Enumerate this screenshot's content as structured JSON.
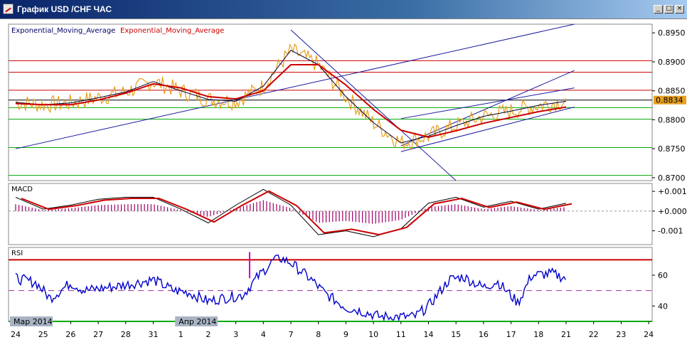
{
  "window": {
    "title": "График USD /CHF ЧАС",
    "minimize_label": "_",
    "maximize_label": "□",
    "close_label": "×"
  },
  "legend": {
    "ema1": "Exponential_Moving_Average",
    "ema2": "Exponential_Moving_Average",
    "macd": "MACD",
    "rsi": "RSI"
  },
  "colors": {
    "price": "#e8a020",
    "ema_fast": "#000033",
    "ema_slow": "#cc0000",
    "trend": "#1a1aa0",
    "level_red": "#cc0000",
    "level_green": "#00aa00",
    "macd_hist": "#990066",
    "rsi_line": "#0000cc",
    "rsi_spike": "#cc00cc",
    "current_badge": "#e8a020"
  },
  "current_price": "0.8834",
  "chart_data": [
    {
      "type": "line",
      "title": "",
      "ylim": [
        0.8695,
        0.8965
      ],
      "yticks": [
        "0.8950",
        "0.8900",
        "0.8850",
        "0.8800",
        "0.8750",
        "0.8700"
      ],
      "ytick_values": [
        0.895,
        0.89,
        0.885,
        0.88,
        0.875,
        0.87
      ],
      "x_labels": [
        "24",
        "25",
        "26",
        "27",
        "28",
        "31",
        "1",
        "2",
        "3",
        "4",
        "7",
        "8",
        "9",
        "10",
        "11",
        "14",
        "15",
        "16",
        "17",
        "18",
        "21",
        "22",
        "23",
        "24"
      ],
      "period_labels": [
        "Мар 2014",
        "Апр 2014"
      ],
      "horizontal_levels": {
        "red": [
          0.8902,
          0.8882,
          0.8851
        ],
        "black": [
          0.8834
        ],
        "green": [
          0.8821,
          0.8801,
          0.8752,
          0.8704
        ]
      },
      "series": [
        {
          "name": "Exponential_Moving_Average",
          "points": [
            [
              0,
              0.883
            ],
            [
              1,
              0.8826
            ],
            [
              2,
              0.8829
            ],
            [
              3,
              0.8838
            ],
            [
              4,
              0.8848
            ],
            [
              5,
              0.8866
            ],
            [
              6,
              0.885
            ],
            [
              7,
              0.8835
            ],
            [
              8,
              0.8832
            ],
            [
              9,
              0.8858
            ],
            [
              10,
              0.892
            ],
            [
              11,
              0.8895
            ],
            [
              12,
              0.884
            ],
            [
              13,
              0.8795
            ],
            [
              14,
              0.876
            ],
            [
              15,
              0.8772
            ],
            [
              16,
              0.879
            ],
            [
              17,
              0.8806
            ],
            [
              18,
              0.8815
            ],
            [
              19,
              0.8825
            ],
            [
              20,
              0.8832
            ]
          ]
        },
        {
          "name": "Exponential_Moving_Average",
          "points": [
            [
              0,
              0.8828
            ],
            [
              1,
              0.8826
            ],
            [
              2,
              0.8826
            ],
            [
              3,
              0.8834
            ],
            [
              4,
              0.8846
            ],
            [
              5,
              0.8862
            ],
            [
              6,
              0.8855
            ],
            [
              7,
              0.884
            ],
            [
              8,
              0.8836
            ],
            [
              9,
              0.885
            ],
            [
              10,
              0.8895
            ],
            [
              11,
              0.8895
            ],
            [
              12,
              0.886
            ],
            [
              13,
              0.8818
            ],
            [
              14,
              0.8782
            ],
            [
              15,
              0.877
            ],
            [
              16,
              0.8781
            ],
            [
              17,
              0.8794
            ],
            [
              18,
              0.8804
            ],
            [
              19,
              0.8814
            ],
            [
              20,
              0.8822
            ]
          ]
        }
      ]
    },
    {
      "type": "line",
      "title": "",
      "ylim": [
        -0.0017,
        0.0014
      ],
      "yticks": [
        "+0.001",
        "+0.000",
        "-0.001"
      ],
      "ytick_values": [
        0.001,
        0.0,
        -0.001
      ],
      "series": [
        {
          "name": "MACD",
          "points": [
            [
              0,
              0.0007
            ],
            [
              1,
              0.0001
            ],
            [
              2,
              0.0003
            ],
            [
              3,
              0.0006
            ],
            [
              4,
              0.0007
            ],
            [
              5,
              0.0007
            ],
            [
              6,
              0.0001
            ],
            [
              7,
              -0.0006
            ],
            [
              8,
              0.0003
            ],
            [
              9,
              0.0011
            ],
            [
              10,
              0.0003
            ],
            [
              11,
              -0.0012
            ],
            [
              12,
              -0.001
            ],
            [
              13,
              -0.0013
            ],
            [
              14,
              -0.0009
            ],
            [
              15,
              0.0004
            ],
            [
              16,
              0.0007
            ],
            [
              17,
              0.0002
            ],
            [
              18,
              0.0005
            ],
            [
              19,
              0.0001
            ],
            [
              20,
              0.0004
            ]
          ]
        }
      ]
    },
    {
      "type": "line",
      "title": "",
      "ylim": [
        30,
        78
      ],
      "yticks": [
        "60",
        "40"
      ],
      "ytick_values": [
        60,
        40
      ],
      "horizontal_levels": {
        "upper": 70,
        "middle": 50,
        "lower": 30
      },
      "series": [
        {
          "name": "RSI",
          "points": [
            [
              0,
              58
            ],
            [
              0.6,
              55
            ],
            [
              1,
              45
            ],
            [
              1.6,
              55
            ],
            [
              2,
              50
            ],
            [
              3,
              53
            ],
            [
              4,
              57
            ],
            [
              4.6,
              50
            ],
            [
              5,
              49
            ],
            [
              5.6,
              43
            ],
            [
              6,
              45
            ],
            [
              6.6,
              47
            ],
            [
              7,
              58
            ],
            [
              7.6,
              72
            ],
            [
              8,
              68
            ],
            [
              8.6,
              57
            ],
            [
              9,
              48
            ],
            [
              9.6,
              39
            ],
            [
              10,
              37
            ],
            [
              10.6,
              33
            ],
            [
              11,
              33
            ],
            [
              11.6,
              33
            ],
            [
              12,
              40
            ],
            [
              12.6,
              57
            ],
            [
              13,
              59
            ],
            [
              13.6,
              52
            ],
            [
              14,
              56
            ],
            [
              14.6,
              42
            ],
            [
              15,
              60
            ],
            [
              15.6,
              61
            ],
            [
              16,
              58
            ]
          ]
        }
      ]
    }
  ]
}
